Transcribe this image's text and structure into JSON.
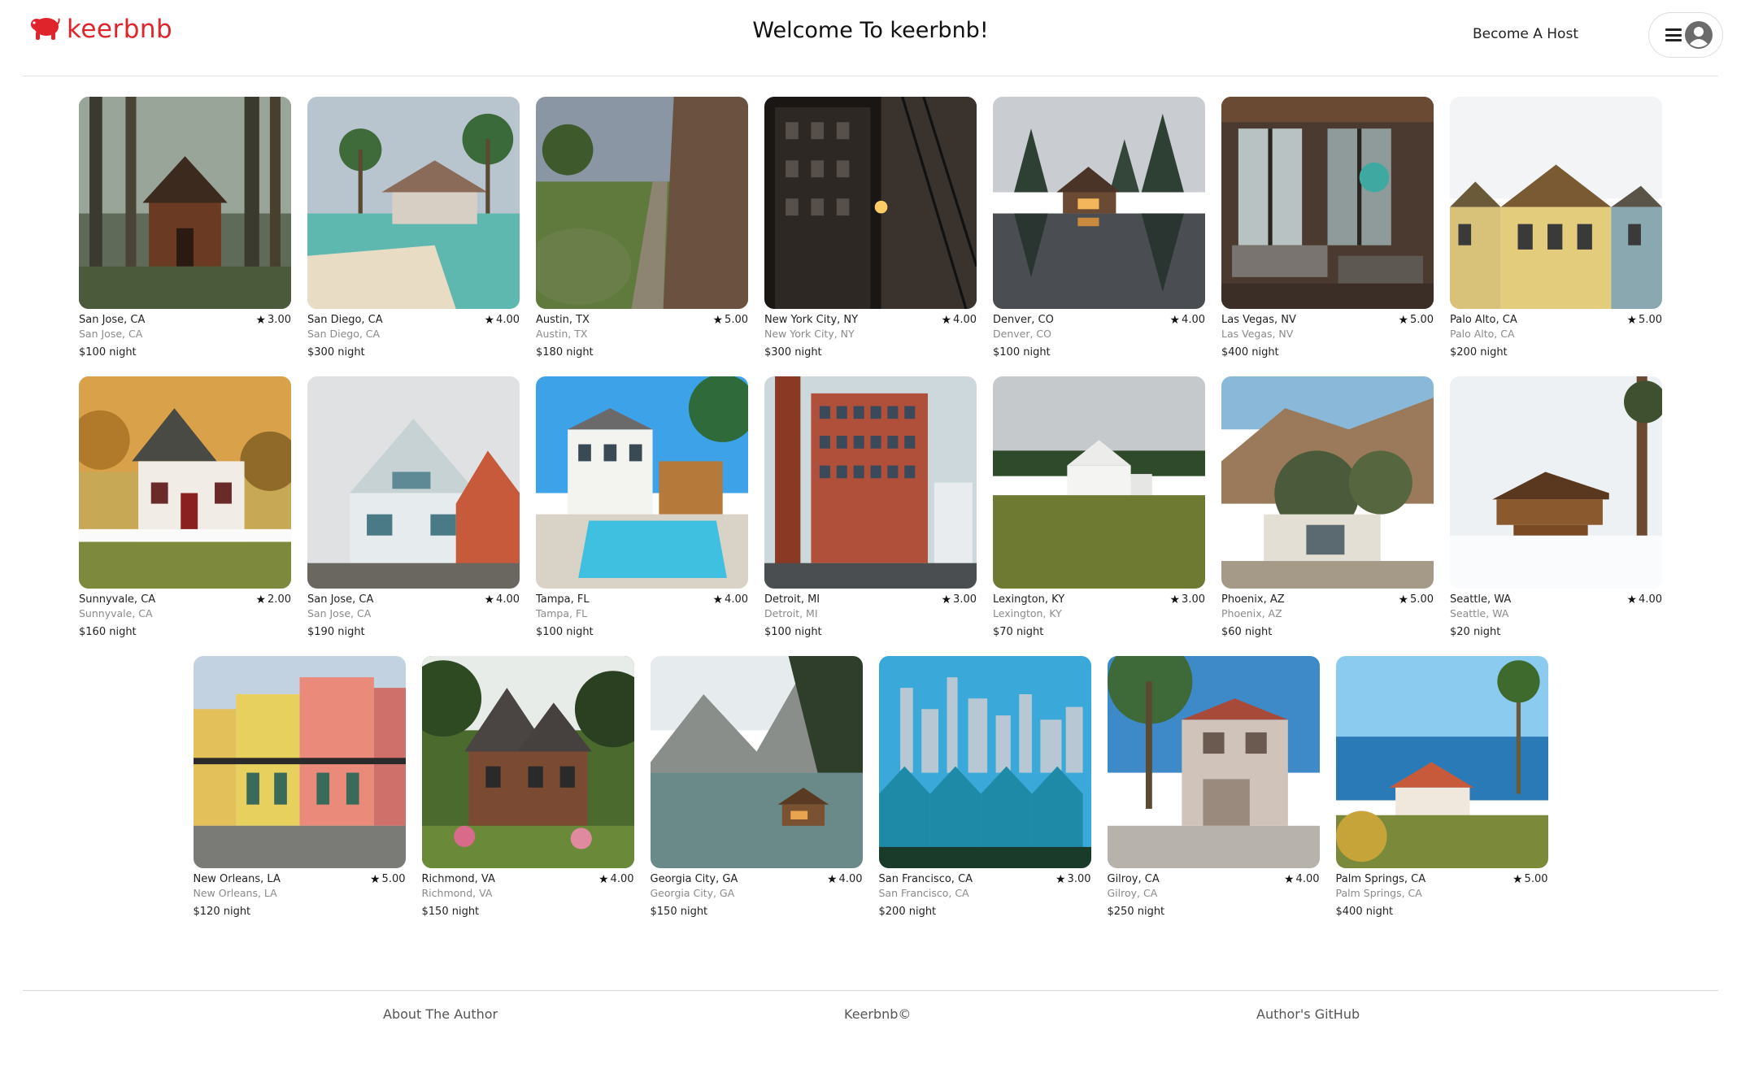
{
  "header": {
    "logo_text": "keerbnb",
    "welcome": "Welcome To keerbnb!",
    "become_host": "Become A Host"
  },
  "listings": [
    {
      "title": "San Jose, CA",
      "rating": "3.00",
      "subtitle": "San Jose, CA",
      "price": "$100 night",
      "scene": "forest-cabin"
    },
    {
      "title": "San Diego, CA",
      "rating": "4.00",
      "subtitle": "San Diego, CA",
      "price": "$300 night",
      "scene": "beach-house"
    },
    {
      "title": "Austin, TX",
      "rating": "5.00",
      "subtitle": "Austin, TX",
      "price": "$180 night",
      "scene": "village-path"
    },
    {
      "title": "New York City, NY",
      "rating": "4.00",
      "subtitle": "New York City, NY",
      "price": "$300 night",
      "scene": "city-night"
    },
    {
      "title": "Denver, CO",
      "rating": "4.00",
      "subtitle": "Denver, CO",
      "price": "$100 night",
      "scene": "lake-lodge"
    },
    {
      "title": "Las Vegas, NV",
      "rating": "5.00",
      "subtitle": "Las Vegas, NV",
      "price": "$400 night",
      "scene": "loft-interior"
    },
    {
      "title": "Palo Alto, CA",
      "rating": "5.00",
      "subtitle": "Palo Alto, CA",
      "price": "$200 night",
      "scene": "victorian-row"
    },
    {
      "title": "Sunnyvale, CA",
      "rating": "2.00",
      "subtitle": "Sunnyvale, CA",
      "price": "$160 night",
      "scene": "white-cottage"
    },
    {
      "title": "San Jose, CA",
      "rating": "4.00",
      "subtitle": "San Jose, CA",
      "price": "$190 night",
      "scene": "grey-house"
    },
    {
      "title": "Tampa, FL",
      "rating": "4.00",
      "subtitle": "Tampa, FL",
      "price": "$100 night",
      "scene": "pool-villa"
    },
    {
      "title": "Detroit, MI",
      "rating": "3.00",
      "subtitle": "Detroit, MI",
      "price": "$100 night",
      "scene": "brick-building"
    },
    {
      "title": "Lexington, KY",
      "rating": "3.00",
      "subtitle": "Lexington, KY",
      "price": "$70 night",
      "scene": "farmhouse"
    },
    {
      "title": "Phoenix, AZ",
      "rating": "5.00",
      "subtitle": "Phoenix, AZ",
      "price": "$60 night",
      "scene": "desert-home"
    },
    {
      "title": "Seattle, WA",
      "rating": "4.00",
      "subtitle": "Seattle, WA",
      "price": "$20 night",
      "scene": "snow-chalet"
    },
    {
      "title": "New Orleans, LA",
      "rating": "5.00",
      "subtitle": "New Orleans, LA",
      "price": "$120 night",
      "scene": "colorful-street"
    },
    {
      "title": "Richmond, VA",
      "rating": "4.00",
      "subtitle": "Richmond, VA",
      "price": "$150 night",
      "scene": "garden-house"
    },
    {
      "title": "Georgia City, GA",
      "rating": "4.00",
      "subtitle": "Georgia City, GA",
      "price": "$150 night",
      "scene": "mountain-lake"
    },
    {
      "title": "San Francisco, CA",
      "rating": "3.00",
      "subtitle": "San Francisco, CA",
      "price": "$200 night",
      "scene": "city-skyline"
    },
    {
      "title": "Gilroy, CA",
      "rating": "4.00",
      "subtitle": "Gilroy, CA",
      "price": "$250 night",
      "scene": "stucco-house"
    },
    {
      "title": "Palm Springs, CA",
      "rating": "5.00",
      "subtitle": "Palm Springs, CA",
      "price": "$400 night",
      "scene": "coastal-villa"
    }
  ],
  "footer": {
    "about": "About The Author",
    "copyright": "Keerbnb©",
    "github": "Author's GitHub"
  }
}
